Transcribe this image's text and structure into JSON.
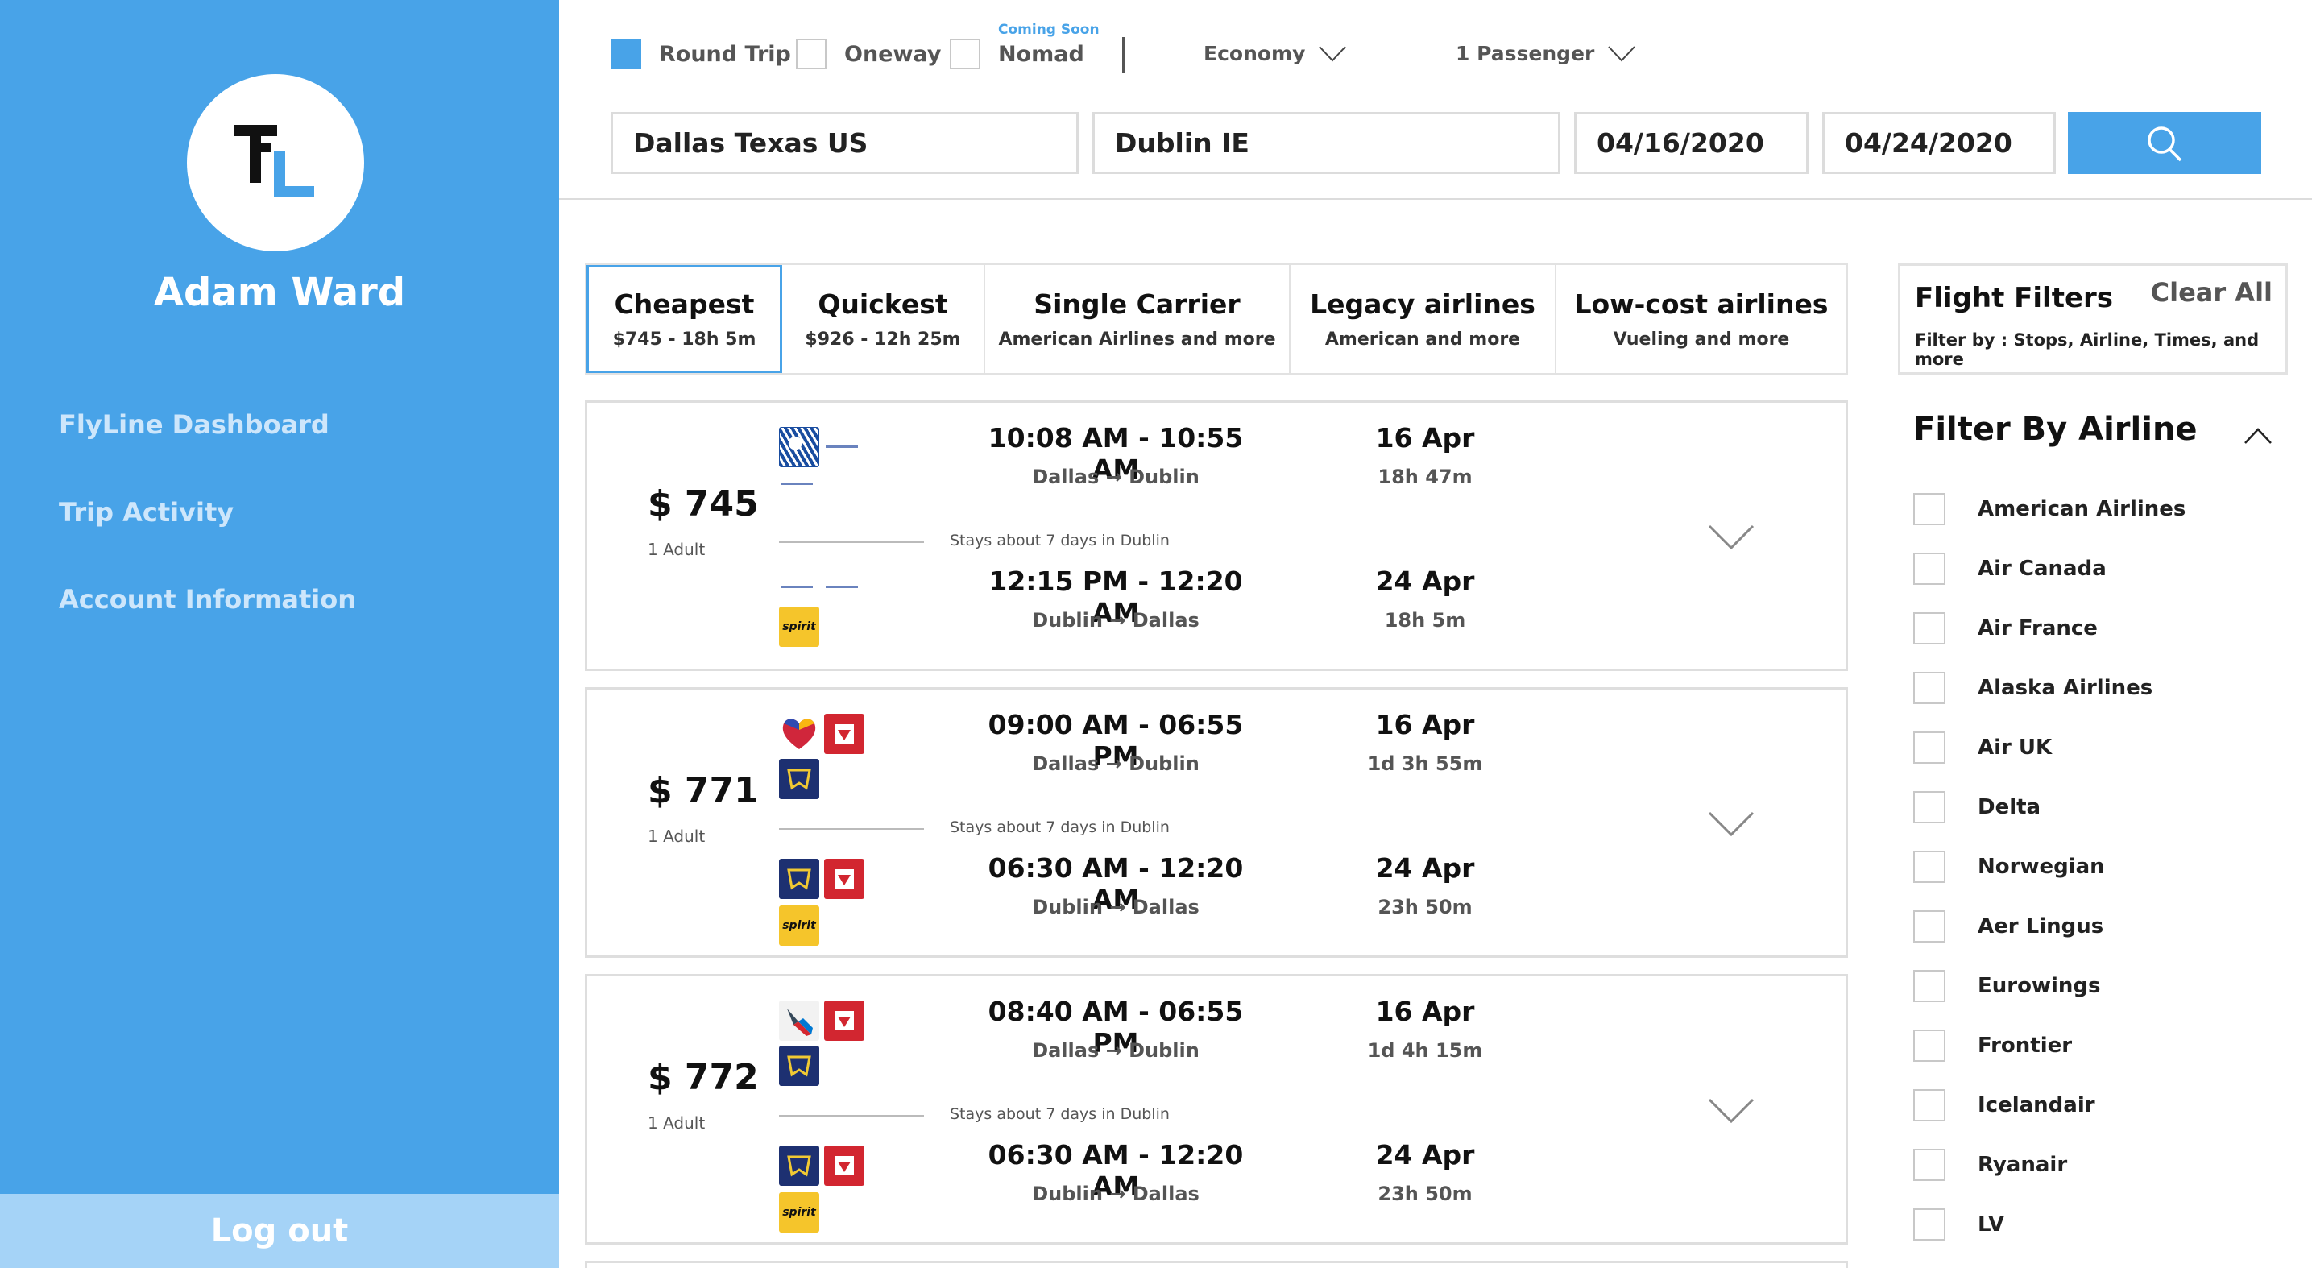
{
  "sidebar": {
    "user_name": "Adam Ward",
    "nav": [
      "FlyLine Dashboard",
      "Trip Activity",
      "Account Information"
    ],
    "logout": "Log out"
  },
  "search": {
    "trip_types": [
      {
        "label": "Round Trip",
        "checked": true
      },
      {
        "label": "Oneway",
        "checked": false
      },
      {
        "label": "Nomad",
        "checked": false
      }
    ],
    "coming_soon": "Coming Soon",
    "cabin": "Economy",
    "passengers": "1 Passenger",
    "from": "Dallas Texas US",
    "to": "Dublin  IE",
    "depart": "04/16/2020",
    "return": "04/24/2020"
  },
  "tabs": [
    {
      "title": "Cheapest",
      "sub": "$745 - 18h 5m",
      "active": true
    },
    {
      "title": "Quickest",
      "sub": "$926 - 12h 25m",
      "active": false
    },
    {
      "title": "Single Carrier",
      "sub": "American Airlines and more",
      "active": false
    },
    {
      "title": "Legacy airlines",
      "sub": "American and more",
      "active": false
    },
    {
      "title": "Low-cost airlines",
      "sub": "Vueling and more",
      "active": false
    }
  ],
  "flights": [
    {
      "price": "$ 745",
      "adults": "1 Adult",
      "stay": "Stays about 7 days in Dublin",
      "out": {
        "times": "10:08 AM - 10:55 AM",
        "from": "Dallas",
        "to": "Dublin",
        "date": "16 Apr",
        "dur": "18h 47m"
      },
      "ret": {
        "times": "12:15 PM - 12:20 AM",
        "from": "Dublin",
        "to": "Dallas",
        "date": "24 Apr",
        "dur": "18h 5m"
      }
    },
    {
      "price": "$ 771",
      "adults": "1 Adult",
      "stay": "Stays about 7 days in Dublin",
      "out": {
        "times": "09:00 AM - 06:55 PM",
        "from": "Dallas",
        "to": "Dublin",
        "date": "16 Apr",
        "dur": "1d 3h 55m"
      },
      "ret": {
        "times": "06:30 AM - 12:20 AM",
        "from": "Dublin",
        "to": "Dallas",
        "date": "24 Apr",
        "dur": "23h 50m"
      }
    },
    {
      "price": "$ 772",
      "adults": "1 Adult",
      "stay": "Stays about 7 days in Dublin",
      "out": {
        "times": "08:40 AM - 06:55 PM",
        "from": "Dallas",
        "to": "Dublin",
        "date": "16 Apr",
        "dur": "1d 4h 15m"
      },
      "ret": {
        "times": "06:30 AM - 12:20 AM",
        "from": "Dublin",
        "to": "Dallas",
        "date": "24 Apr",
        "dur": "23h 50m"
      }
    }
  ],
  "filters": {
    "title": "Flight Filters",
    "clear": "Clear All",
    "sub": "Filter by : Stops, Airline, Times, and more",
    "airline_head": "Filter By Airline",
    "airlines": [
      "American Airlines",
      "Air Canada",
      "Air France",
      "Alaska Airlines",
      "Air UK",
      "Delta",
      "Norwegian",
      "Aer Lingus",
      "Eurowings",
      "Frontier",
      "Icelandair",
      "Ryanair",
      "LV"
    ]
  },
  "logo_text": {
    "spirit": "spirit"
  },
  "colors": {
    "accent": "#48a3e8",
    "logout_bg": "#a5d3f7"
  }
}
